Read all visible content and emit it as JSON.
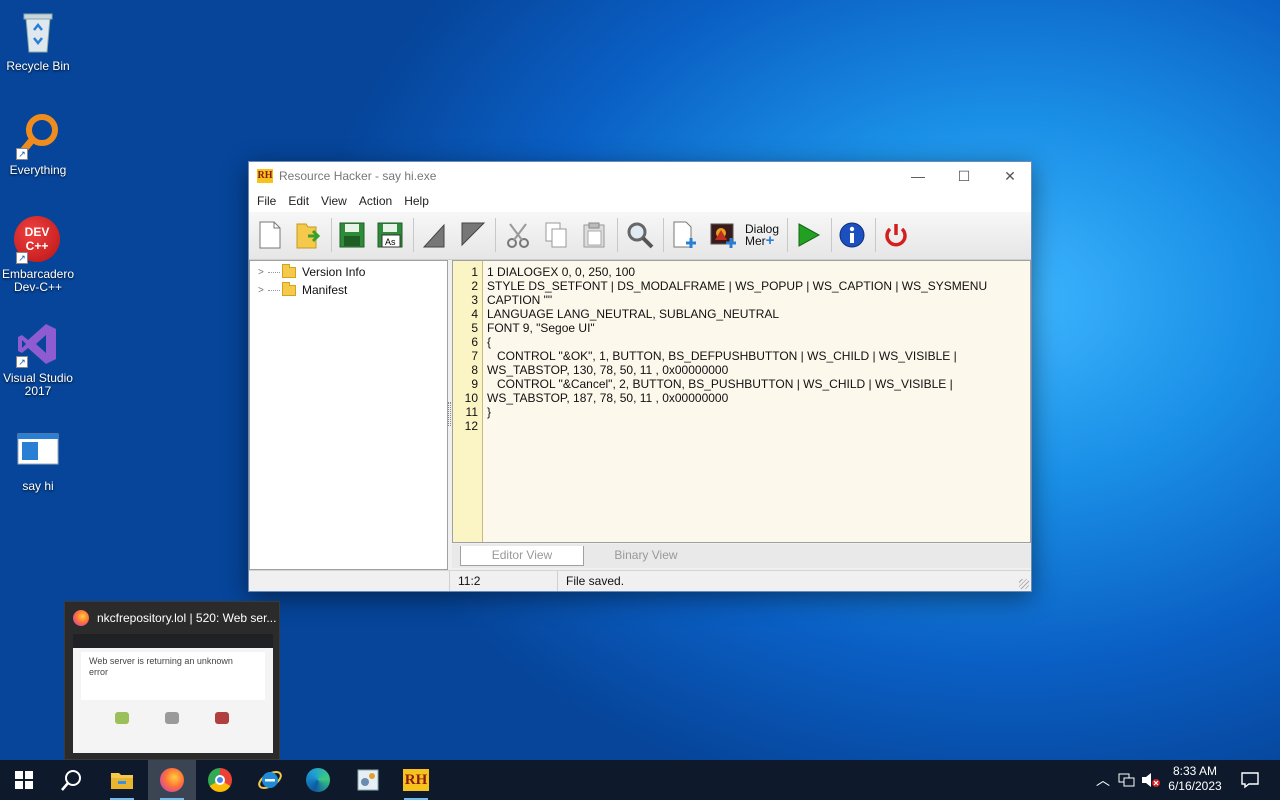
{
  "desktop": {
    "icons": [
      {
        "label": "Recycle Bin"
      },
      {
        "label": "Everything"
      },
      {
        "label": "Embarcadero Dev-C++"
      },
      {
        "label": "Visual Studio 2017"
      },
      {
        "label": "say hi"
      }
    ],
    "devcpp_logo_text": "DEV C++"
  },
  "window": {
    "title": "Resource Hacker - say hi.exe",
    "logo_text": "RH",
    "controls": {
      "minimize": "—",
      "maximize": "☐",
      "close": "✕"
    },
    "menu": [
      "File",
      "Edit",
      "View",
      "Action",
      "Help"
    ],
    "toolbar": {
      "dialog_menu_label_1": "Dialog",
      "dialog_menu_label_2": "Mer"
    },
    "tree": [
      {
        "label": "Version Info"
      },
      {
        "label": "Manifest"
      }
    ],
    "editor": {
      "line_numbers": [
        "1",
        "2",
        "3",
        "4",
        "5",
        "6",
        "7",
        "8",
        "9",
        "10",
        "11",
        "12"
      ],
      "lines": [
        "1 DIALOGEX 0, 0, 250, 100",
        "STYLE DS_SETFONT | DS_MODALFRAME | WS_POPUP | WS_CAPTION | WS_SYSMENU",
        "CAPTION \"\"",
        "LANGUAGE LANG_NEUTRAL, SUBLANG_NEUTRAL",
        "FONT 9, \"Segoe UI\"",
        "{",
        "   CONTROL \"&OK\", 1, BUTTON, BS_DEFPUSHBUTTON | WS_CHILD | WS_VISIBLE |",
        "WS_TABSTOP, 130, 78, 50, 11 , 0x00000000",
        "   CONTROL \"&Cancel\", 2, BUTTON, BS_PUSHBUTTON | WS_CHILD | WS_VISIBLE |",
        "WS_TABSTOP, 187, 78, 50, 11 , 0x00000000",
        "}",
        ""
      ]
    },
    "tabs": [
      "Editor View",
      "Binary View"
    ],
    "status": {
      "position": "11:2",
      "message": "File saved."
    }
  },
  "preview": {
    "title": "nkcfrepository.lol | 520: Web ser...",
    "thumb_heading": "Web server is returning an unknown error"
  },
  "taskbar": {
    "rh_label": "RH",
    "time": "8:33 AM",
    "date": "6/16/2023"
  },
  "colors": {
    "desktop_accent": "#1a8fe6",
    "taskbar": "#0e1a2b",
    "editor_bg": "#fdf8ec",
    "gutter_bg": "#fbf5c5"
  }
}
